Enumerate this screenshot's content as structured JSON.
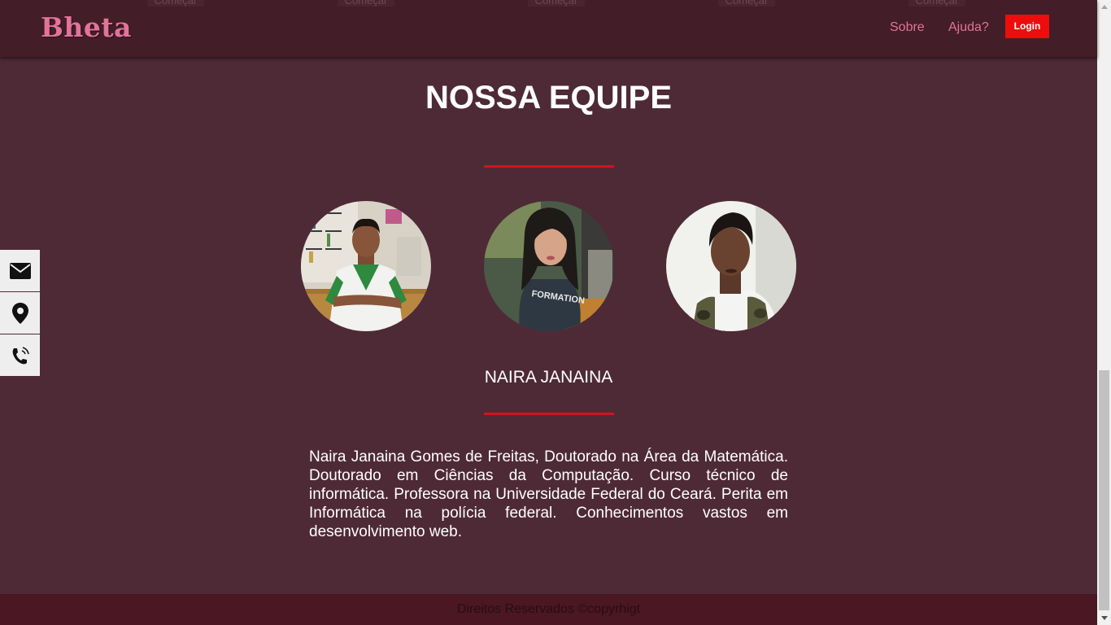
{
  "header": {
    "logo": "Bheta",
    "nav": {
      "sobre": "Sobre",
      "ajuda": "Ajuda?"
    },
    "login_label": "Login",
    "ghost_button_label": "Começar"
  },
  "team": {
    "title": "NOSSA EQUIPE",
    "members": [
      {
        "icon": "member-photo-1"
      },
      {
        "icon": "member-photo-2"
      },
      {
        "icon": "member-photo-3"
      }
    ],
    "selected": {
      "name": "NAIRA JANAINA",
      "bio": "Naira Janaina Gomes de Freitas, Doutorado na Área da Matemática. Doutorado em Ciências da Computação. Curso técnico de informática. Professora na Universidade Federal do Ceará. Perita em Informática na polícia federal. Conhecimentos vastos em desenvolvimento web."
    }
  },
  "side_bar": {
    "icons": [
      "envelope-icon",
      "map-marker-icon",
      "phone-icon"
    ]
  },
  "footer": {
    "text": "Direitos Reservados ©copyrhigt"
  },
  "colors": {
    "background": "#4e2a36",
    "header": "#431d27",
    "logo": "#e2739a",
    "accent_red": "#ee0c0c",
    "divider": "#d6121b",
    "footer": "#4a1722"
  }
}
